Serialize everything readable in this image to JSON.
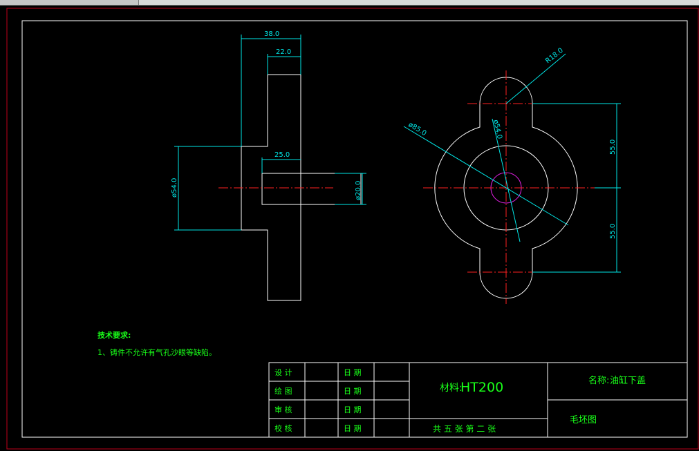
{
  "app": {
    "colors": {
      "background": "#000000",
      "outer_frame": "#c0001a",
      "inner_frame": "#ffffff",
      "geometry": "#ffffff",
      "dimension": "#00e8e8",
      "centerline": "#ff2020",
      "hole": "#e020e0",
      "annotation_text": "#19ff19"
    }
  },
  "side_view": {
    "dim_overall_width": "38.0",
    "dim_flange_width": "22.0",
    "dim_hub_length": "25.0",
    "dim_hub_diameter": "ø54.0",
    "dim_bore_diameter": "ø20.0"
  },
  "front_view": {
    "dim_lobe_radius": "R18.0",
    "dim_outer_diameter": "ø85.0",
    "dim_inner_diameter": "ø54.0",
    "dim_upper_offset": "55.0",
    "dim_lower_offset": "55.0"
  },
  "notes": {
    "title": "技术要求:",
    "line1": "1、铸件不允许有气孔沙眼等缺陷。"
  },
  "title_block": {
    "rows": [
      {
        "role": "设  计",
        "date_label": "日  期"
      },
      {
        "role": "绘  图",
        "date_label": "日  期"
      },
      {
        "role": "审  核",
        "date_label": "日  期"
      },
      {
        "role": "校  核",
        "date_label": "日  期"
      }
    ],
    "material_label": "材料:",
    "material_value": "HT200",
    "sheet_info": "共  五  张      第  二  张",
    "name_label": "名称:",
    "name_value": "油缸下盖",
    "drawing_type": "毛坯图"
  }
}
